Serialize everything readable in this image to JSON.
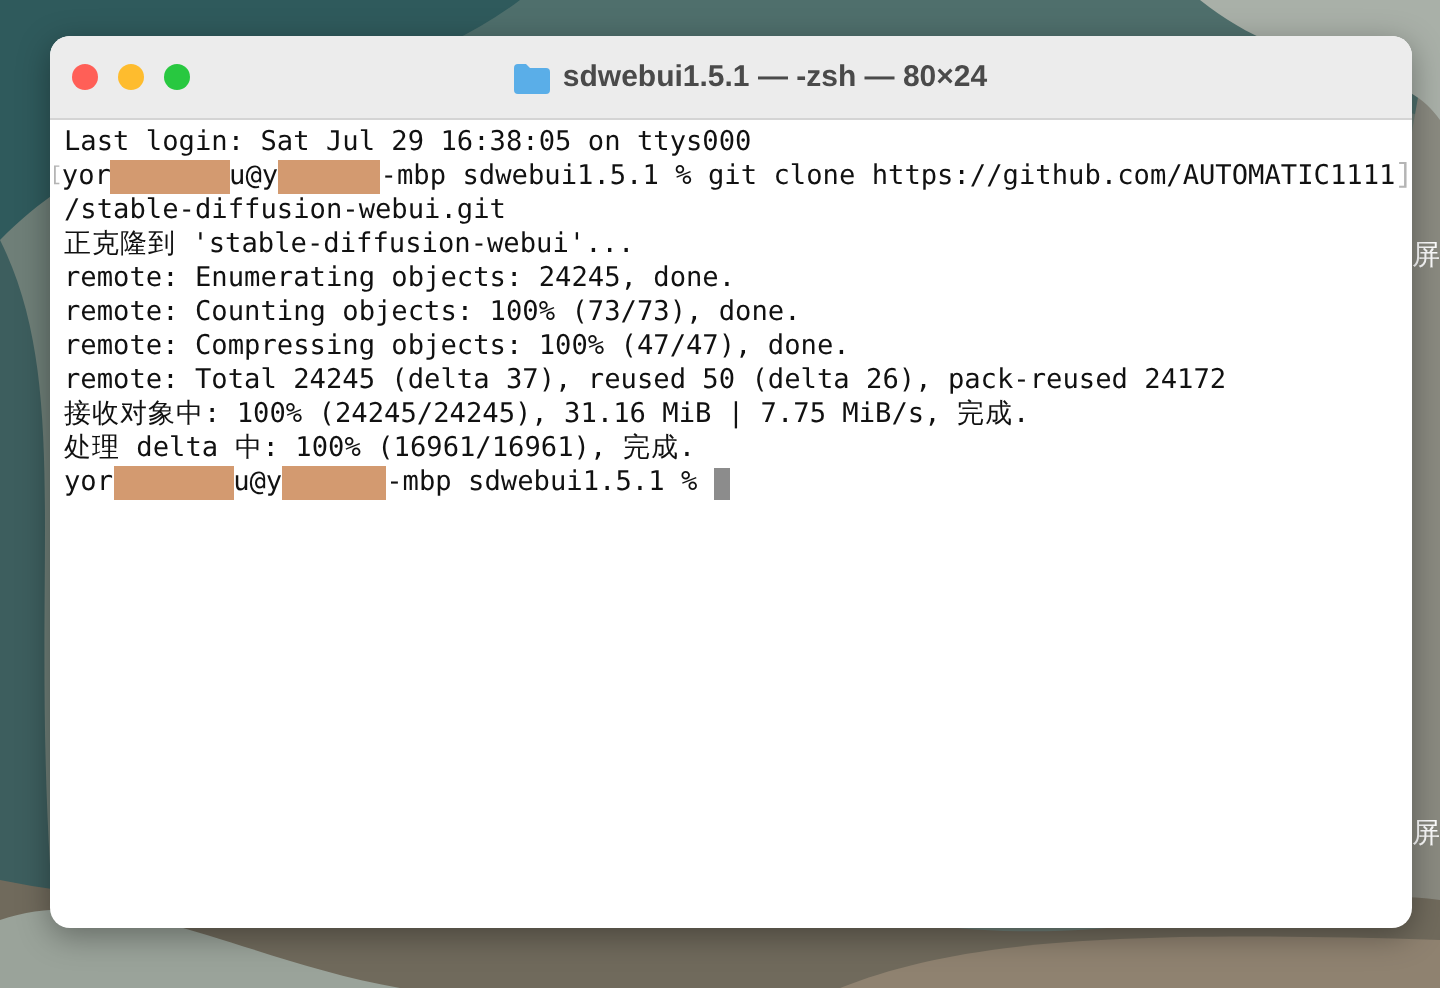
{
  "desktop": {
    "labels": [
      "屏",
      "屏"
    ]
  },
  "window": {
    "title": "sdwebui1.5.1 — -zsh — 80×24"
  },
  "terminal": {
    "lines": [
      {
        "segments": [
          {
            "kind": "text",
            "text": "Last login: Sat Jul 29 16:38:05 on ttys000"
          }
        ]
      },
      {
        "segments": [
          {
            "kind": "bracket",
            "text": "["
          },
          {
            "kind": "text",
            "text": "yor"
          },
          {
            "kind": "redacted"
          },
          {
            "kind": "text",
            "text": "u@y"
          },
          {
            "kind": "redacted"
          },
          {
            "kind": "text",
            "text": "-mbp sdwebui1.5.1 % git clone https://github.com/AUTOMATIC1111"
          },
          {
            "kind": "bracket",
            "text": "]"
          }
        ]
      },
      {
        "segments": [
          {
            "kind": "text",
            "text": "/stable-diffusion-webui.git"
          }
        ]
      },
      {
        "segments": [
          {
            "kind": "text",
            "text": "正克隆到 'stable-diffusion-webui'..."
          }
        ]
      },
      {
        "segments": [
          {
            "kind": "text",
            "text": "remote: Enumerating objects: 24245, done."
          }
        ]
      },
      {
        "segments": [
          {
            "kind": "text",
            "text": "remote: Counting objects: 100% (73/73), done."
          }
        ]
      },
      {
        "segments": [
          {
            "kind": "text",
            "text": "remote: Compressing objects: 100% (47/47), done."
          }
        ]
      },
      {
        "segments": [
          {
            "kind": "text",
            "text": "remote: Total 24245 (delta 37), reused 50 (delta 26), pack-reused 24172"
          }
        ]
      },
      {
        "segments": [
          {
            "kind": "text",
            "text": "接收对象中: 100% (24245/24245), 31.16 MiB | 7.75 MiB/s, 完成."
          }
        ]
      },
      {
        "segments": [
          {
            "kind": "text",
            "text": "处理 delta 中: 100% (16961/16961), 完成."
          }
        ]
      },
      {
        "segments": [
          {
            "kind": "text",
            "text": "yor"
          },
          {
            "kind": "redacted"
          },
          {
            "kind": "text",
            "text": "u@y"
          },
          {
            "kind": "redacted"
          },
          {
            "kind": "text",
            "text": "-mbp sdwebui1.5.1 % "
          },
          {
            "kind": "cursor"
          }
        ]
      }
    ]
  }
}
